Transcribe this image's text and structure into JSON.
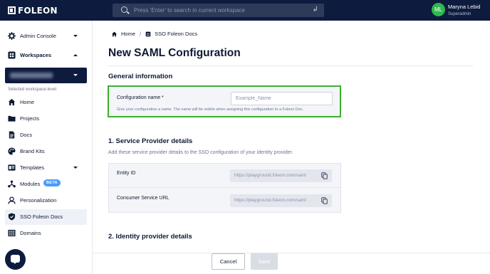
{
  "topbar": {
    "logo_text": "FOLEON",
    "search_placeholder": "Press 'Enter' to search in current workspace",
    "user": {
      "initials": "ML",
      "name": "Maryna Lebid",
      "role": "Superadmin",
      "avatar_color": "#2fb84d"
    }
  },
  "sidebar": {
    "admin_console": "Admin Console",
    "workspaces": "Workspaces",
    "workspace_name": "Foleon - Playground",
    "workspace_level": "Selected workspace-level",
    "items": [
      {
        "label": "Home",
        "icon": "home-icon"
      },
      {
        "label": "Projects",
        "icon": "folder-icon"
      },
      {
        "label": "Docs",
        "icon": "doc-icon"
      },
      {
        "label": "Brand Kits",
        "icon": "palette-icon"
      },
      {
        "label": "Templates",
        "icon": "templates-icon"
      },
      {
        "label": "Modules",
        "icon": "modules-icon",
        "badge": "BETA"
      },
      {
        "label": "Personalization",
        "icon": "person-icon"
      },
      {
        "label": "SSO Foleon Docs",
        "icon": "shield-icon",
        "active": true
      },
      {
        "label": "Domains",
        "icon": "domains-icon"
      }
    ]
  },
  "breadcrumb": {
    "home": "Home",
    "current": "SSO Foleon Docs"
  },
  "page": {
    "title": "New SAML Configuration",
    "general": {
      "heading": "General information",
      "config_label": "Configuration name *",
      "config_placeholder": "Example_Name",
      "config_help": "Give your configuration a name. The name will be visible when assigning this configuration to a Foleon Doc."
    },
    "service_provider": {
      "heading": "1. Service Provider details",
      "subtitle": "Add these service provider details to the SSO configuration of your identity provider.",
      "rows": [
        {
          "label": "Entity ID",
          "value": "https://playground.foleon.com/saml"
        },
        {
          "label": "Consumer Service URL",
          "value": "https://playground.foleon.com/saml"
        }
      ]
    },
    "identity_provider": {
      "heading": "2. Identity provider details"
    }
  },
  "footer": {
    "cancel": "Cancel",
    "save": "Save"
  },
  "colors": {
    "navy": "#0d1b3e",
    "highlight": "#3cb02f",
    "beta": "#4a9bff"
  }
}
